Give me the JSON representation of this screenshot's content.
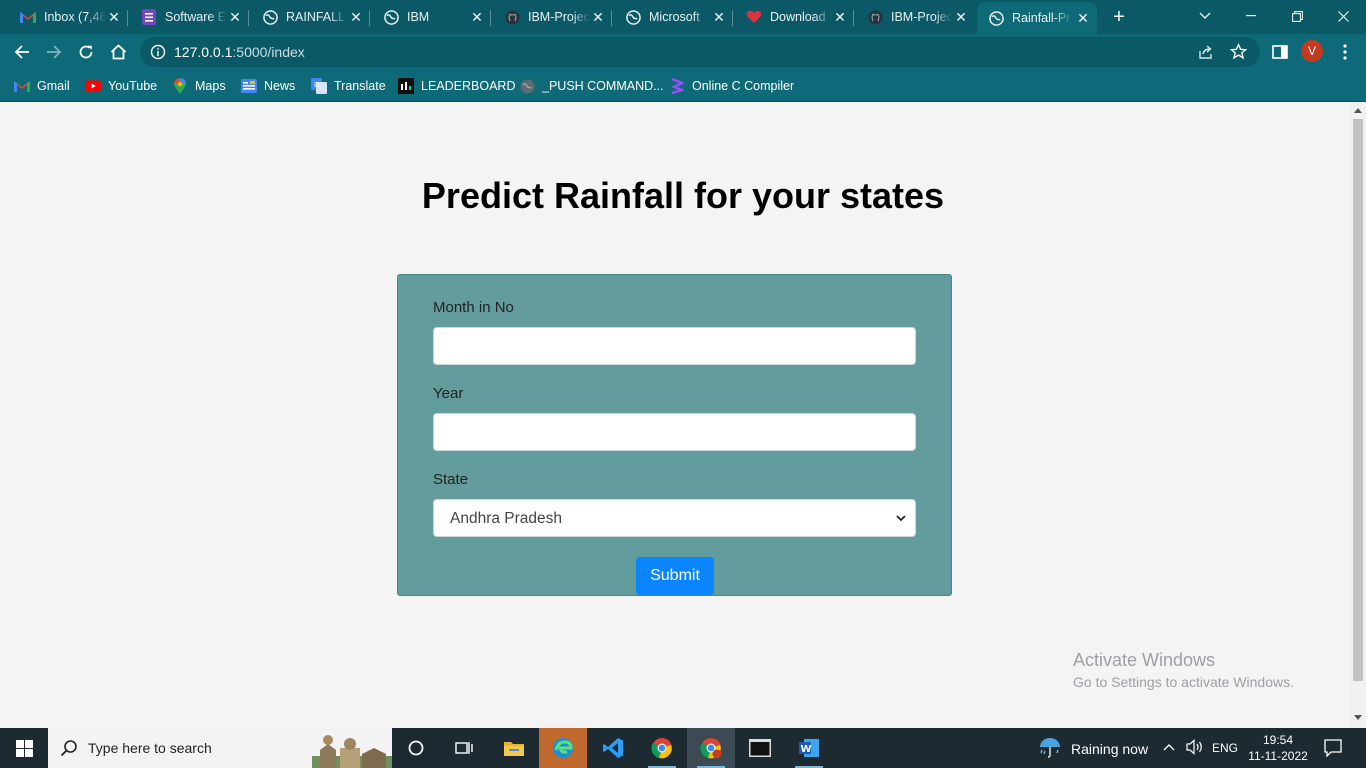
{
  "browser": {
    "tabs": [
      {
        "label": "Inbox (7,46",
        "icon": "gmail-icon",
        "active": false
      },
      {
        "label": "Software E",
        "icon": "forms-icon",
        "active": false
      },
      {
        "label": "RAINFALL",
        "icon": "globe-icon",
        "active": false
      },
      {
        "label": "IBM",
        "icon": "globe-icon",
        "active": false
      },
      {
        "label": "IBM-Projec",
        "icon": "github-icon",
        "active": false
      },
      {
        "label": "Microsoft",
        "icon": "globe-icon",
        "active": false
      },
      {
        "label": "Download",
        "icon": "heart-icon",
        "active": false
      },
      {
        "label": "IBM-Projec",
        "icon": "github-icon",
        "active": false
      },
      {
        "label": "Rainfall-Pr",
        "icon": "globe-icon",
        "active": true
      }
    ],
    "url": {
      "host": "127.0.0.1",
      "path": ":5000/index"
    },
    "profile_initial": "V",
    "bookmarks": [
      {
        "label": "Gmail",
        "icon": "gmail-icon"
      },
      {
        "label": "YouTube",
        "icon": "youtube-icon"
      },
      {
        "label": "Maps",
        "icon": "maps-icon"
      },
      {
        "label": "News",
        "icon": "news-icon"
      },
      {
        "label": "Translate",
        "icon": "translate-icon"
      },
      {
        "label": "LEADERBOARD",
        "icon": "leaderboard-icon"
      },
      {
        "label": "_PUSH COMMAND...",
        "icon": "globe-icon"
      },
      {
        "label": "Online C Compiler",
        "icon": "compiler-icon"
      }
    ],
    "colors": {
      "frame": "#0b5866",
      "toolbar": "#0e6a78"
    }
  },
  "page": {
    "heading": "Predict Rainfall for your states",
    "form": {
      "month_label": "Month in No",
      "month_value": "",
      "year_label": "Year",
      "year_value": "",
      "state_label": "State",
      "state_selected": "Andhra Pradesh",
      "submit_label": "Submit"
    },
    "colors": {
      "card": "#629c9c",
      "button": "#0b84ff"
    },
    "watermark": {
      "title": "Activate Windows",
      "subtitle": "Go to Settings to activate Windows."
    }
  },
  "taskbar": {
    "search_placeholder": "Type here to search",
    "weather": "Raining now",
    "language": "ENG",
    "time": "19:54",
    "date": "11-11-2022"
  }
}
